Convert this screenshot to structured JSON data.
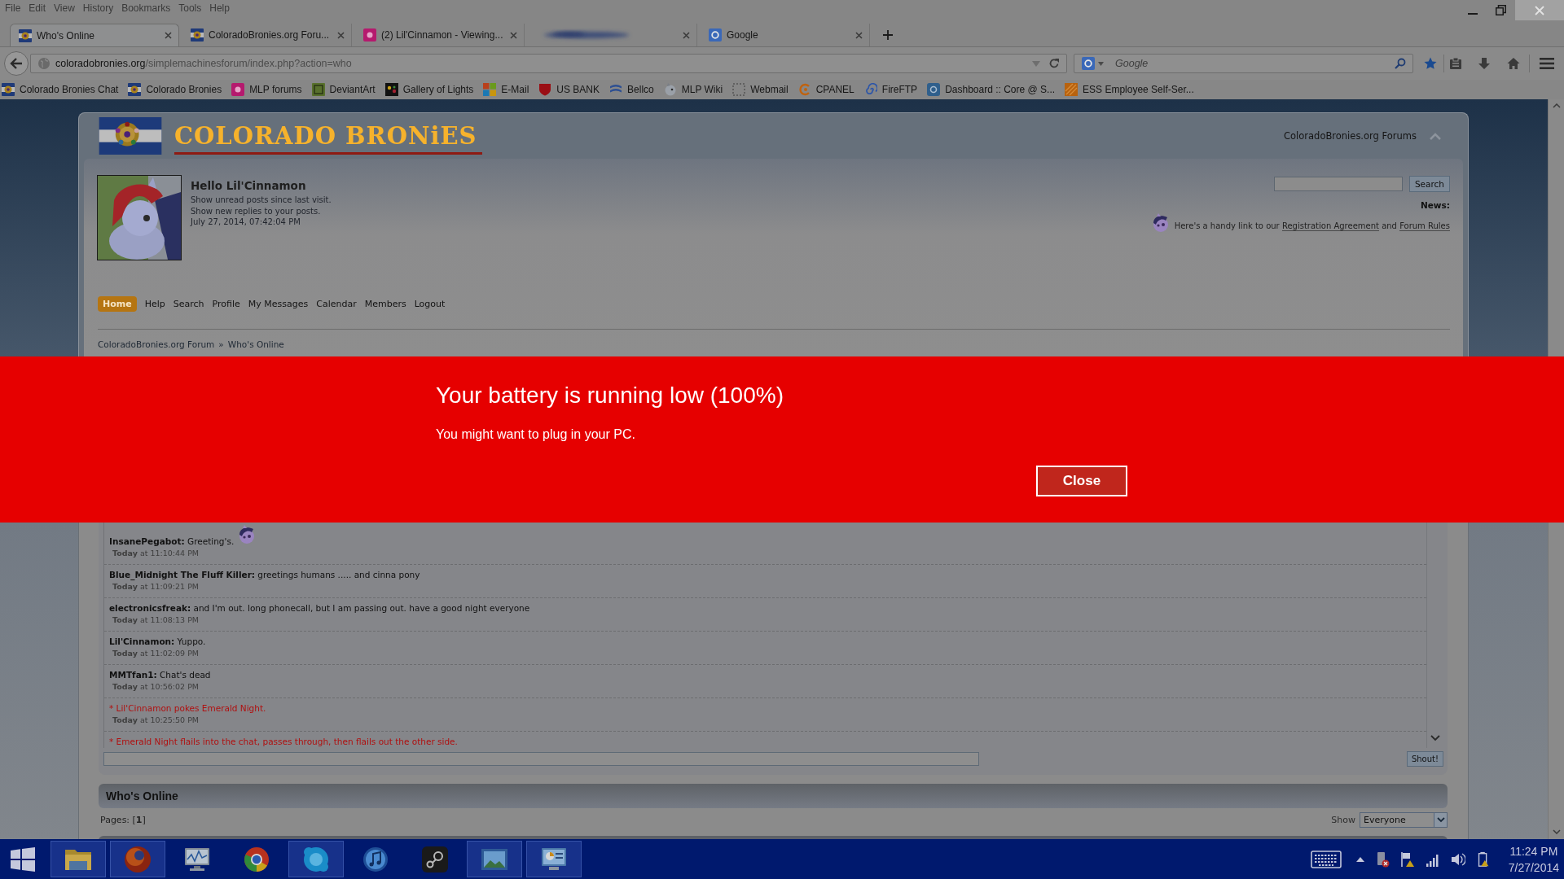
{
  "menu_bar": [
    "File",
    "Edit",
    "View",
    "History",
    "Bookmarks",
    "Tools",
    "Help"
  ],
  "tabs": [
    {
      "kind": "flag",
      "label": "Who's Online",
      "selected": true
    },
    {
      "kind": "flag",
      "label": "ColoradoBronies.org Foru...",
      "selected": false
    },
    {
      "kind": "pinktile",
      "label": "(2) Lil'Cinnamon - Viewing...",
      "selected": false
    },
    {
      "kind": "redacted",
      "selected": false
    },
    {
      "kind": "google",
      "label": "Google",
      "selected": false
    }
  ],
  "address_bar": {
    "domain": "coloradobronies.org",
    "path": "/simplemachinesforum/index.php?action=who"
  },
  "search_bar": {
    "placeholder": "Google"
  },
  "bookmarks": [
    {
      "kind": "flag",
      "label": "Colorado Bronies Chat"
    },
    {
      "kind": "flag",
      "label": "Colorado Bronies"
    },
    {
      "kind": "pinktile",
      "label": "MLP forums"
    },
    {
      "kind": "greentile",
      "label": "DeviantArt"
    },
    {
      "kind": "blacktile",
      "label": "Gallery of Lights"
    },
    {
      "kind": "quad",
      "label": "E-Mail"
    },
    {
      "kind": "shield",
      "label": "US BANK"
    },
    {
      "kind": "stripes",
      "label": "Bellco"
    },
    {
      "kind": "pony",
      "label": "MLP Wiki"
    },
    {
      "kind": "dashed",
      "label": "Webmail"
    },
    {
      "kind": "swoosh",
      "label": "CPANEL"
    },
    {
      "kind": "spiral",
      "label": "FireFTP"
    },
    {
      "kind": "bluetile",
      "label": "Dashboard :: Core @ S..."
    },
    {
      "kind": "orangetile",
      "label": "ESS Employee Self-Ser..."
    }
  ],
  "forum": {
    "site_title": "COLORADO BRONiES",
    "header_link": "ColoradoBronies.org Forums",
    "greeting": "Hello Lil'Cinnamon",
    "user_links": [
      "Show unread posts since last visit.",
      "Show new replies to your posts."
    ],
    "date": "July 27, 2014, 07:42:04 PM",
    "search_button": "Search",
    "news_label": "News:",
    "news": {
      "before": "Here's a handy link to our ",
      "link_1": "Registration Agreement",
      "between": " and ",
      "link_2": "Forum Rules"
    },
    "nav": [
      {
        "label": "Home",
        "selected": true
      },
      {
        "label": "Help",
        "selected": false
      },
      {
        "label": "Search",
        "selected": false
      },
      {
        "label": "Profile",
        "selected": false
      },
      {
        "label": "My Messages",
        "selected": false
      },
      {
        "label": "Calendar",
        "selected": false
      },
      {
        "label": "Members",
        "selected": false
      },
      {
        "label": "Logout",
        "selected": false
      }
    ],
    "breadcrumb": {
      "items": [
        "ColoradoBronies.org Forum",
        "Who's Online"
      ],
      "separator": "»"
    }
  },
  "notification": {
    "title": "Your battery is running low (100%)",
    "message": "You might want to plug in your PC.",
    "button": "Close"
  },
  "shoutbox": {
    "messages": [
      {
        "kind": "message",
        "text": "**InsanePegabot:** Greeting's.",
        "emote": true,
        "time": "**Today** at 11:10:44 PM"
      },
      {
        "kind": "message",
        "text": "**Blue_Midnight The Fluff Killer:** greetings humans ..... and cinna pony",
        "emote": false,
        "time": "**Today** at 11:09:21 PM"
      },
      {
        "kind": "message",
        "text": "**electronicsfreak:** and I'm out. long phonecall, but I am passing out. have a good night everyone",
        "emote": false,
        "time": "**Today** at 11:08:13 PM"
      },
      {
        "kind": "message",
        "text": "**Lil'Cinnamon:** Yuppo.",
        "emote": false,
        "time": "**Today** at 11:02:09 PM"
      },
      {
        "kind": "message",
        "text": "**MMTfan1:** Chat's dead",
        "emote": false,
        "time": "**Today** at 10:56:02 PM"
      },
      {
        "kind": "action",
        "text": "* Lil'Cinnamon pokes Emerald Night.",
        "emote": false,
        "time": "**Today** at 10:25:50 PM"
      },
      {
        "kind": "action",
        "text": "* Emerald Night flails into the chat, passes through, then flails out the other side.",
        "emote": false
      }
    ],
    "shout_button": "Shout!"
  },
  "whos_online": {
    "title": "Who's Online",
    "pages": "Pages: [**1**]",
    "show_label": "Show",
    "show_value": "Everyone"
  },
  "taskbar": {
    "apps": [
      {
        "kind": "folder",
        "running": true
      },
      {
        "kind": "orb",
        "running": true
      },
      {
        "kind": "monitor",
        "running": false
      },
      {
        "kind": "ring",
        "running": false
      },
      {
        "kind": "chat",
        "running": true
      },
      {
        "kind": "music",
        "running": false
      },
      {
        "kind": "game",
        "running": false
      },
      {
        "kind": "photo",
        "running": true
      },
      {
        "kind": "panel",
        "running": true
      }
    ],
    "clock": {
      "time": "11:24 PM",
      "date": "7/27/2014"
    }
  }
}
